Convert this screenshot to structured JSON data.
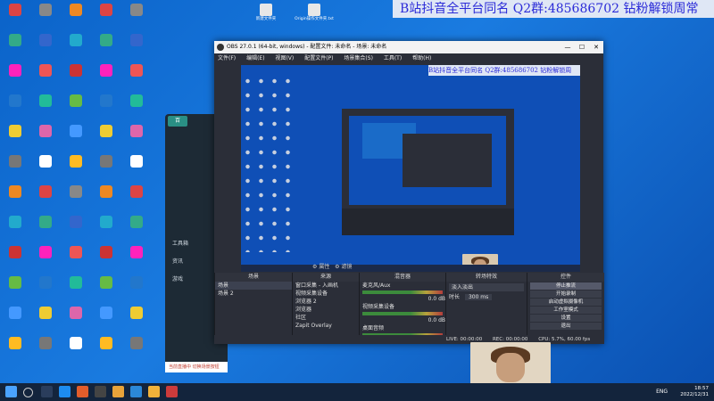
{
  "banner": {
    "text": "B站抖音全平台同名  Q2群:485686702  钻粉解锁周常"
  },
  "desktop": {
    "top_files": [
      "新建文件夹",
      "Origin操作文件夹.txt"
    ],
    "icon_colors": [
      "#d44",
      "#3a8",
      "#f2b",
      "#27c",
      "#ec3",
      "#777",
      "#e82",
      "#2ac",
      "#c33",
      "#6b4",
      "#49f",
      "#fb2",
      "#888",
      "#36c",
      "#e55",
      "#2b9",
      "#d6a",
      "#fff"
    ]
  },
  "background_app": {
    "tag": "百",
    "labels": [
      "工具箱",
      "资讯",
      "游戏"
    ],
    "status": "当前直播中 切换场景按钮"
  },
  "obs": {
    "title": "OBS 27.0.1 (64-bit, windows) - 配置文件: 未命名 - 场景: 未命名",
    "menu": [
      "文件(F)",
      "编辑(E)",
      "视图(V)",
      "配置文件(P)",
      "场景集合(S)",
      "工具(T)",
      "帮助(H)"
    ],
    "preview_banner": "B站抖音全平台同名  Q2群:485686702  钻粉解锁周",
    "source_bar": {
      "properties": "属性",
      "filters": "滤镜"
    },
    "docks": {
      "scenes": {
        "header": "场景",
        "items": [
          "场景",
          "场景 2"
        ]
      },
      "sources": {
        "header": "来源",
        "items": [
          "窗口采集 - 入画机",
          "视频采集设备",
          "浏览器 2",
          "浏览器",
          "社区",
          "Zapit Overlay"
        ]
      },
      "mixer": {
        "header": "混音器",
        "channels": [
          {
            "name": "麦克风/Aux",
            "db": "0.0 dB"
          },
          {
            "name": "视频采集设备",
            "db": "0.0 dB"
          },
          {
            "name": "桌面音频",
            "db": "0.0 dB"
          }
        ]
      },
      "transitions": {
        "header": "转场特效",
        "type": "淡入淡出",
        "duration_label": "时长",
        "duration": "300 ms"
      },
      "controls": {
        "header": "控件",
        "buttons": [
          "停止推流",
          "开始录制",
          "启动虚拟摄像机",
          "工作室模式",
          "设置",
          "退出"
        ]
      }
    },
    "status": {
      "live": "LIVE: 00:00:00",
      "rec": "REC: 00:00:00",
      "cpu": "CPU: 5.7%, 60.00 fps"
    }
  },
  "taskbar": {
    "lang": "ENG",
    "time": "18:57",
    "date": "2022/12/31"
  }
}
